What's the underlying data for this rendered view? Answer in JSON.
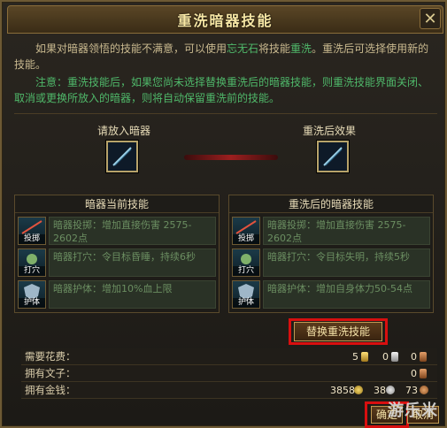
{
  "window": {
    "title": "重洗暗器技能",
    "close_label": "✕"
  },
  "description": {
    "p1_a": "如果对暗器领悟的技能不满意，可以使用",
    "p1_item": "忘无石",
    "p1_b": "将技能",
    "p1_action": "重洗",
    "p1_c": "。重洗后可选择使用新的技能。",
    "p2": "注意：重洗技能后，如果您尚未选择替换重洗后的暗器技能，则重洗技能界面关闭、取消或更换所放入的暗器，则将自动保留重洗前的技能。"
  },
  "slots": {
    "left_label": "请放入暗器",
    "right_label": "重洗后效果"
  },
  "current_skills": {
    "title": "暗器当前技能",
    "items": [
      {
        "icon_label": "投掷",
        "text": "暗器投掷：增加直接伤害 2575-2602点"
      },
      {
        "icon_label": "打穴",
        "text": "暗器打穴：令目标昏睡，持续6秒"
      },
      {
        "icon_label": "护体",
        "text": "暗器护体：增加10%血上限"
      }
    ]
  },
  "new_skills": {
    "title": "重洗后的暗器技能",
    "items": [
      {
        "icon_label": "投掷",
        "text": "暗器投掷：增加直接伤害 2575-2602点"
      },
      {
        "icon_label": "打穴",
        "text": "暗器打穴：令目标失明，持续5秒"
      },
      {
        "icon_label": "护体",
        "text": "暗器护体：增加自身体力50-54点"
      }
    ]
  },
  "replace_button": "替换重洗技能",
  "costs": {
    "need_label": "需要花费：",
    "need_gold": "5",
    "need_silver": "0",
    "need_copper": "0",
    "own_stone_label": "拥有文子：",
    "own_stone": "0",
    "own_money_label": "拥有金钱：",
    "own_gold": "3858",
    "own_silver": "38",
    "own_copper": "73"
  },
  "buttons": {
    "confirm": "确定",
    "cancel": "取消"
  },
  "watermark": "游乐米",
  "colors": {
    "accent_green": "#4fb86a",
    "highlight_red": "#d80f0f",
    "gold_text": "#f7e7a5"
  }
}
